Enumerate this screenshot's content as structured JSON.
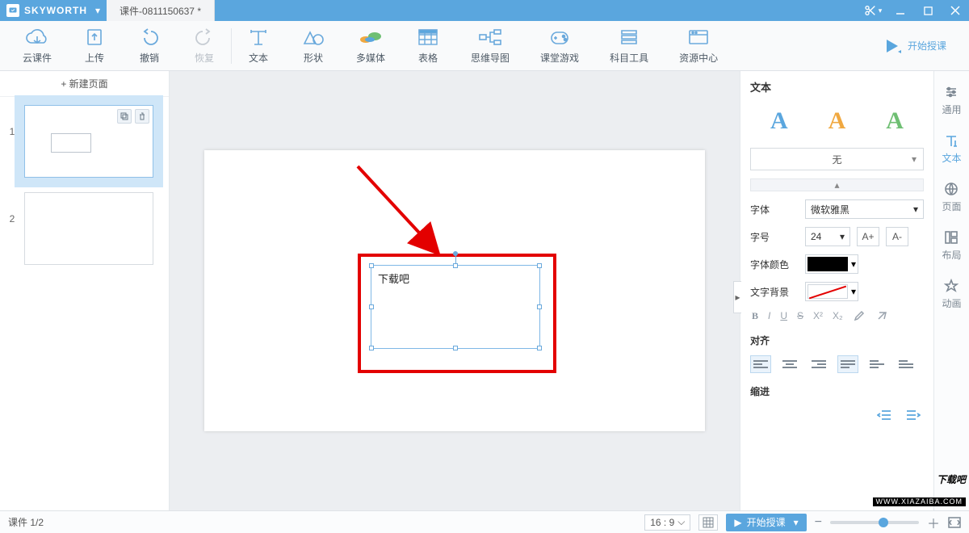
{
  "titlebar": {
    "brand": "SKYWORTH",
    "tab": "课件-0811150637 *"
  },
  "ribbon": {
    "items": [
      {
        "label": "云课件"
      },
      {
        "label": "上传"
      },
      {
        "label": "撤销"
      },
      {
        "label": "恢复",
        "disabled": true
      },
      {
        "label": "文本"
      },
      {
        "label": "形状"
      },
      {
        "label": "多媒体"
      },
      {
        "label": "表格"
      },
      {
        "label": "思维导图"
      },
      {
        "label": "课堂游戏"
      },
      {
        "label": "科目工具"
      },
      {
        "label": "资源中心"
      }
    ],
    "start": "开始授课"
  },
  "thumbs": {
    "newpage": "+ 新建页面",
    "items": [
      {
        "n": "1"
      },
      {
        "n": "2"
      }
    ]
  },
  "canvas": {
    "textbox": "下载吧"
  },
  "props": {
    "title": "文本",
    "none": "无",
    "font_label": "字体",
    "font_value": "微软雅黑",
    "size_label": "字号",
    "size_value": "24",
    "inc": "A+",
    "dec": "A-",
    "color_label": "字体颜色",
    "bg_label": "文字背景",
    "format": {
      "b": "B",
      "i": "I",
      "u": "U",
      "s": "S",
      "sup": "X²",
      "sub": "X₂"
    },
    "align_title": "对齐",
    "indent_title": "缩进"
  },
  "vtabs": [
    {
      "label": "通用"
    },
    {
      "label": "文本",
      "active": true
    },
    {
      "label": "页面"
    },
    {
      "label": "布局"
    },
    {
      "label": "动画"
    }
  ],
  "status": {
    "page": "课件 1/2",
    "ratio": "16 : 9",
    "start": "开始授课"
  },
  "watermark": {
    "main": "下载吧",
    "sub": "WWW.XIAZAIBA.COM"
  }
}
